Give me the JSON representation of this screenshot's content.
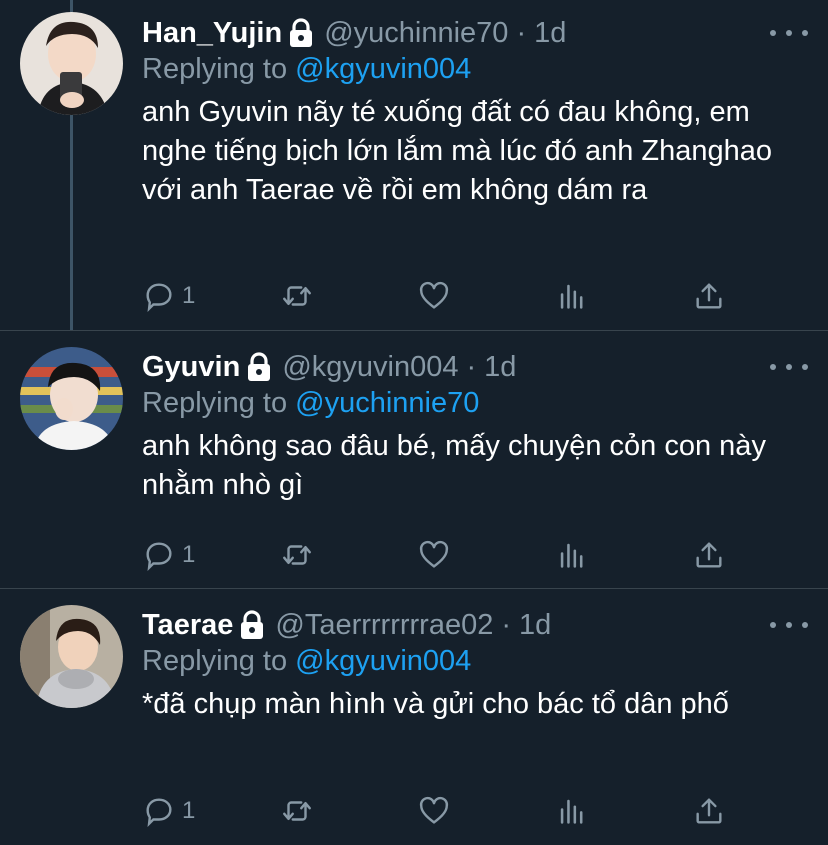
{
  "tweets": [
    {
      "name": "Han_Yujin",
      "handle": "@yuchinnie70",
      "dot": "·",
      "time": "1d",
      "reply_prefix": "Replying to",
      "reply_to": "@kgyuvin004",
      "text": "anh Gyuvin nãy té xuống đất có đau không, em nghe tiếng bịch lớn lắm mà lúc đó anh Zhanghao với anh Taerae về rồi em không dám ra",
      "reply_count": "1"
    },
    {
      "name": "Gyuvin",
      "handle": "@kgyuvin004",
      "dot": "·",
      "time": "1d",
      "reply_prefix": "Replying to",
      "reply_to": "@yuchinnie70",
      "text": "anh không sao đâu bé, mấy chuyện cỏn con này nhằm nhò gì",
      "reply_count": "1"
    },
    {
      "name": "Taerae",
      "handle": "@Taerrrrrrrrae02",
      "dot": "·",
      "time": "1d",
      "reply_prefix": "Replying to",
      "reply_to": "@kgyuvin004",
      "text": "*đã chụp màn hình và gửi cho bác tổ dân phố",
      "reply_count": "1"
    }
  ],
  "icons": {
    "lock": "lock-icon",
    "more": "more-icon",
    "reply": "reply-icon",
    "retweet": "retweet-icon",
    "like": "heart-icon",
    "stats": "stats-icon",
    "share": "share-icon"
  },
  "colors": {
    "background": "#15202b",
    "muted": "#8899a6",
    "accent": "#1da1f2",
    "divider": "#38444d"
  }
}
